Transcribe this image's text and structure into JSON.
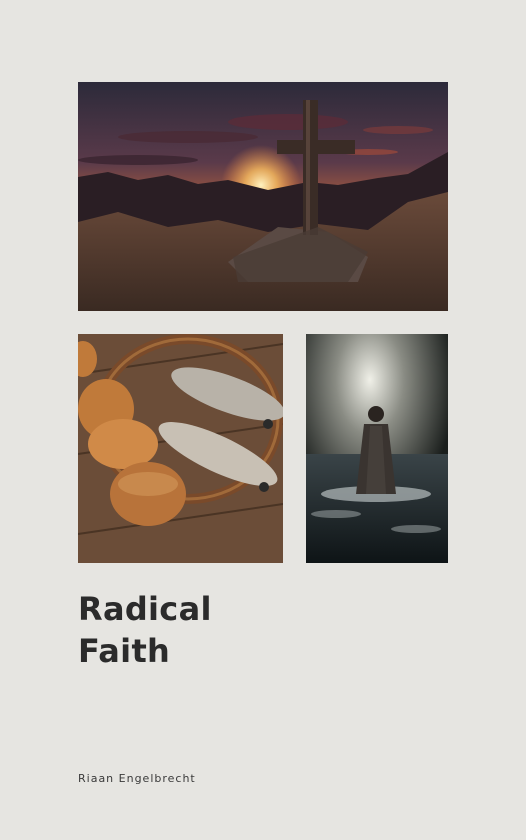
{
  "cover": {
    "title_line1": "Radical",
    "title_line2": "Faith",
    "author": "Riaan Engelbrecht"
  },
  "images": {
    "top": "cross-on-mountain-sunset",
    "bottom_left": "bread-and-fish-basket",
    "bottom_right": "figure-walking-on-water"
  },
  "colors": {
    "background": "#e6e5e1",
    "title": "#2b2b2b"
  }
}
